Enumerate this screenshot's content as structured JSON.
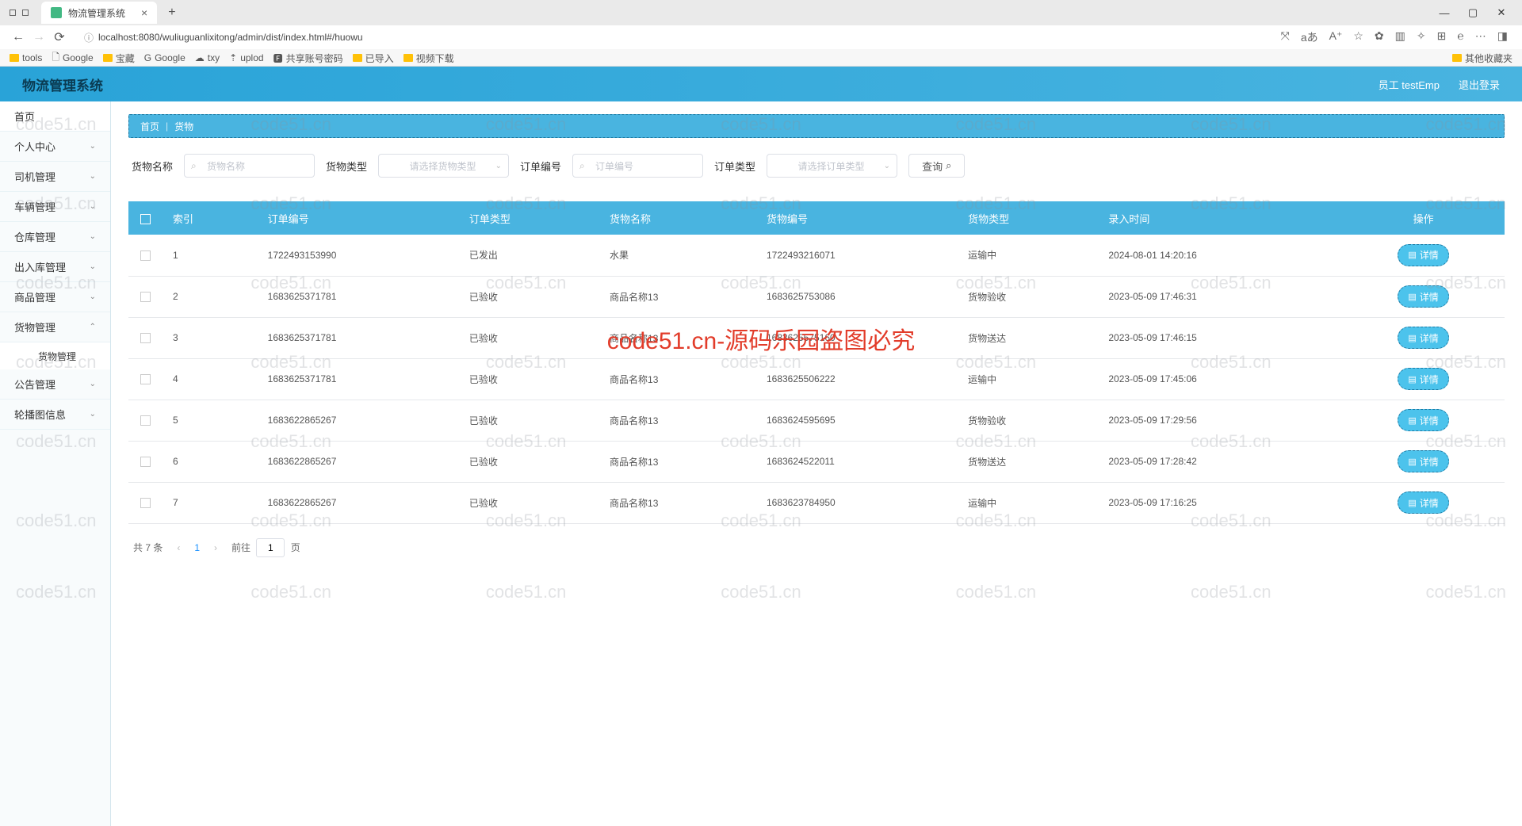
{
  "browser": {
    "tab_title": "物流管理系统",
    "url": "localhost:8080/wuliuguanlixitong/admin/dist/index.html#/huowu",
    "bookmarks": [
      "tools",
      "Google",
      "宝藏",
      "Google",
      "txy",
      "uplod",
      "共享账号密码",
      "已导入",
      "视频下载"
    ],
    "more_bookmarks": "其他收藏夹"
  },
  "header": {
    "app_title": "物流管理系统",
    "user_label": "员工 testEmp",
    "logout": "退出登录"
  },
  "sidebar": {
    "home": "首页",
    "items": [
      "个人中心",
      "司机管理",
      "车辆管理",
      "仓库管理",
      "出入库管理",
      "商品管理",
      "货物管理",
      "公告管理",
      "轮播图信息"
    ],
    "sub_cargo": "货物管理"
  },
  "breadcrumb": {
    "home": "首页",
    "current": "货物"
  },
  "filters": {
    "label_name": "货物名称",
    "ph_name": "货物名称",
    "label_type": "货物类型",
    "ph_type": "请选择货物类型",
    "label_orderno": "订单编号",
    "ph_orderno": "订单编号",
    "label_ordertype": "订单类型",
    "ph_ordertype": "请选择订单类型",
    "search": "查询"
  },
  "table": {
    "headers": [
      "索引",
      "订单编号",
      "订单类型",
      "货物名称",
      "货物编号",
      "货物类型",
      "录入时间",
      "操作"
    ],
    "detail": "详情",
    "rows": [
      {
        "idx": "1",
        "orderno": "1722493153990",
        "otype": "已发出",
        "name": "水果",
        "code": "1722493216071",
        "ctype": "运输中",
        "time": "2024-08-01 14:20:16"
      },
      {
        "idx": "2",
        "orderno": "1683625371781",
        "otype": "已验收",
        "name": "商品名称13",
        "code": "1683625753086",
        "ctype": "货物验收",
        "time": "2023-05-09 17:46:31"
      },
      {
        "idx": "3",
        "orderno": "1683625371781",
        "otype": "已验收",
        "name": "商品名称13",
        "code": "1683625575160",
        "ctype": "货物送达",
        "time": "2023-05-09 17:46:15"
      },
      {
        "idx": "4",
        "orderno": "1683625371781",
        "otype": "已验收",
        "name": "商品名称13",
        "code": "1683625506222",
        "ctype": "运输中",
        "time": "2023-05-09 17:45:06"
      },
      {
        "idx": "5",
        "orderno": "1683622865267",
        "otype": "已验收",
        "name": "商品名称13",
        "code": "1683624595695",
        "ctype": "货物验收",
        "time": "2023-05-09 17:29:56"
      },
      {
        "idx": "6",
        "orderno": "1683622865267",
        "otype": "已验收",
        "name": "商品名称13",
        "code": "1683624522011",
        "ctype": "货物送达",
        "time": "2023-05-09 17:28:42"
      },
      {
        "idx": "7",
        "orderno": "1683622865267",
        "otype": "已验收",
        "name": "商品名称13",
        "code": "1683623784950",
        "ctype": "运输中",
        "time": "2023-05-09 17:16:25"
      }
    ]
  },
  "pagination": {
    "total": "共 7 条",
    "page": "1",
    "goto": "前往",
    "page_suffix": "页"
  },
  "watermark": {
    "small": "code51.cn",
    "big": "code51.cn-源码乐园盗图必究"
  }
}
